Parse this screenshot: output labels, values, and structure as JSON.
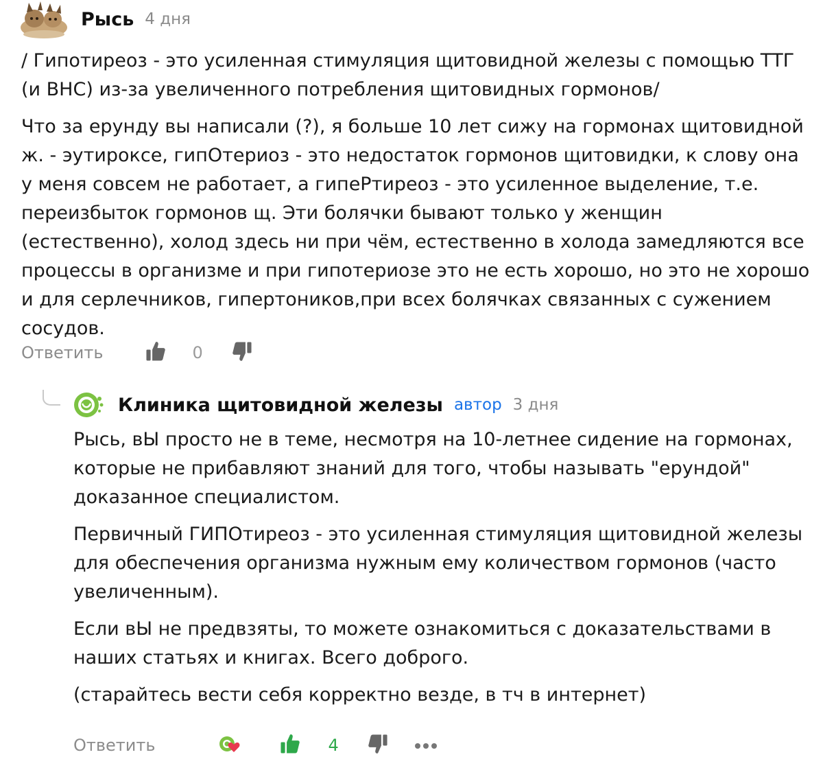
{
  "comment": {
    "author": "Рысь",
    "time": "4 дня",
    "paragraphs": [
      "/ Гипотиреоз - это усиленная стимуляция щитовидной железы с помощью ТТГ (и ВНС) из-за увеличенного потребления щитовидных гормонов/",
      "Что за ерунду вы написали (?), я больше 10 лет сижу на гормонах щитовидной ж. - эутироксе, гипОтериоз - это недостаток гормонов щитовидки, к слову она у меня совсем не работает, а гипеРтиреоз - это усиленное выделение, т.е. переизбыток гормонов щ. Эти болячки бывают только у женщин (естественно), холод здесь ни при чём, естественно в холода замедляются все процессы в организме и при гипотериозе это не есть хорошо, но это не хорошо и для серлечников, гипертоников,при всех болячках связанных с сужением сосудов."
    ],
    "reply_label": "Ответить",
    "likes": "0"
  },
  "reply": {
    "author": "Клиника щитовидной железы",
    "badge": "автор",
    "time": "3 дня",
    "paragraphs": [
      "Рысь, вЫ просто не в теме, несмотря на 10-летнее сидение на гормонах, которые не прибавляют знаний для того, чтобы называть \"ерундой\" доказанное специалистом.",
      "Первичный ГИПОтиреоз - это усиленная стимуляция щитовидной железы для обеспечения организма нужным ему количеством гормонов (часто увеличенным).",
      "Если вЫ не предвзяты, то можете ознакомиться с доказательствами в наших статьях и книгах. Всего доброго.",
      "(старайтесь вести себя корректно везде, в тч в интернет)"
    ],
    "reply_label": "Ответить",
    "likes": "4"
  },
  "colors": {
    "like_active": "#2ea84a",
    "author_badge": "#1a73e8",
    "muted": "#8c8c8c",
    "avatar_green": "#7cc242"
  }
}
